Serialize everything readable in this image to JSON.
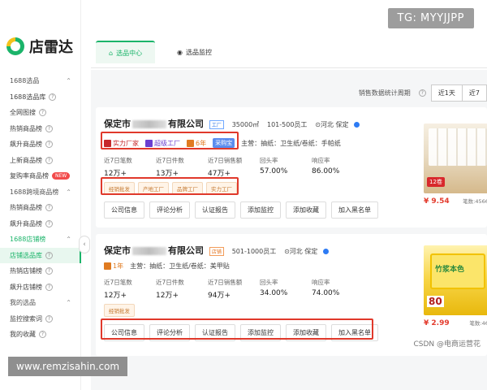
{
  "overlay": {
    "tg": "TG: MYYJJPP",
    "watermark": "www.remzisahin.com",
    "csdn": "CSDN @电商运营花"
  },
  "app": {
    "logo_text": "店雷达"
  },
  "sidebar": {
    "items": [
      {
        "label": "1688选品",
        "type": "group"
      },
      {
        "label": "1688选品库",
        "help": true
      },
      {
        "label": "全网图搜",
        "help": true
      },
      {
        "label": "热销商品榜",
        "help": true
      },
      {
        "label": "飙升商品榜",
        "help": true
      },
      {
        "label": "上新商品榜",
        "help": true
      },
      {
        "label": "复购率商品榜",
        "badge": "NEW"
      },
      {
        "label": "1688跨境商品榜",
        "type": "group"
      },
      {
        "label": "热销商品榜",
        "help": true
      },
      {
        "label": "飙升商品榜",
        "help": true
      },
      {
        "label": "1688店铺榜",
        "type": "group-active"
      },
      {
        "label": "店铺选品库",
        "help": true,
        "active": true
      },
      {
        "label": "热销店铺榜",
        "help": true
      },
      {
        "label": "飙升店铺榜",
        "help": true
      },
      {
        "label": "我的选品",
        "type": "group"
      },
      {
        "label": "监控搜索词",
        "help": true
      },
      {
        "label": "我的收藏",
        "help": true
      }
    ]
  },
  "tabs": [
    {
      "label": "选品中心",
      "icon": "home-icon"
    },
    {
      "label": "选品监控",
      "icon": "eye-icon"
    }
  ],
  "toolbar": {
    "label": "销售数据统计周期",
    "options": [
      "近1天",
      "近7"
    ]
  },
  "cards": [
    {
      "name_prefix": "保定市",
      "name_suffix": "有限公司",
      "name_tag": "工厂",
      "area": "35000㎡",
      "staff": "101-500员工",
      "location": "河北 保定",
      "badges": [
        "实力厂家",
        "超级工厂",
        "6年",
        "采购宝"
      ],
      "main_category": "主营：抽纸：卫生纸/卷纸：手帕纸",
      "stats": [
        {
          "label": "近7日笔数",
          "value": "12万+"
        },
        {
          "label": "近7日件数",
          "value": "13万+"
        },
        {
          "label": "近7日销售额",
          "value": "47万+"
        },
        {
          "label": "回头率",
          "value": "57.00%"
        },
        {
          "label": "响应率",
          "value": "86.00%"
        }
      ],
      "pills": [
        "经销批发",
        "产地工厂",
        "品牌工厂",
        "实力工厂"
      ],
      "actions": [
        "公司信息",
        "评论分析",
        "认证报告",
        "添加监控",
        "添加收藏",
        "加入黑名单"
      ],
      "product": {
        "price": "¥ 9.54",
        "sales": "笔数:45663",
        "label": "12卷"
      }
    },
    {
      "name_prefix": "保定市",
      "name_suffix": "有限公司",
      "name_tag": "店铺",
      "staff": "501-1000员工",
      "location": "河北 保定",
      "badges": [
        "1年"
      ],
      "main_category": "主营：抽纸：卫生纸/卷纸：美甲贴",
      "stats": [
        {
          "label": "近7日笔数",
          "value": "12万+"
        },
        {
          "label": "近7日件数",
          "value": "12万+"
        },
        {
          "label": "近7日销售额",
          "value": "94万+"
        },
        {
          "label": "回头率",
          "value": "34.00%"
        },
        {
          "label": "响应率",
          "value": "74.00%"
        }
      ],
      "pills": [
        "经销批发"
      ],
      "actions": [
        "公司信息",
        "评论分析",
        "认证报告",
        "添加监控",
        "添加收藏",
        "加入黑名单"
      ],
      "product": {
        "price": "¥ 2.99",
        "sales": "笔数:469",
        "label": "80",
        "pack_text": "竹浆本色"
      }
    }
  ],
  "colors": {
    "accent": "#1bb46a",
    "highlight": "#e0392b",
    "price": "#e33c2e"
  }
}
